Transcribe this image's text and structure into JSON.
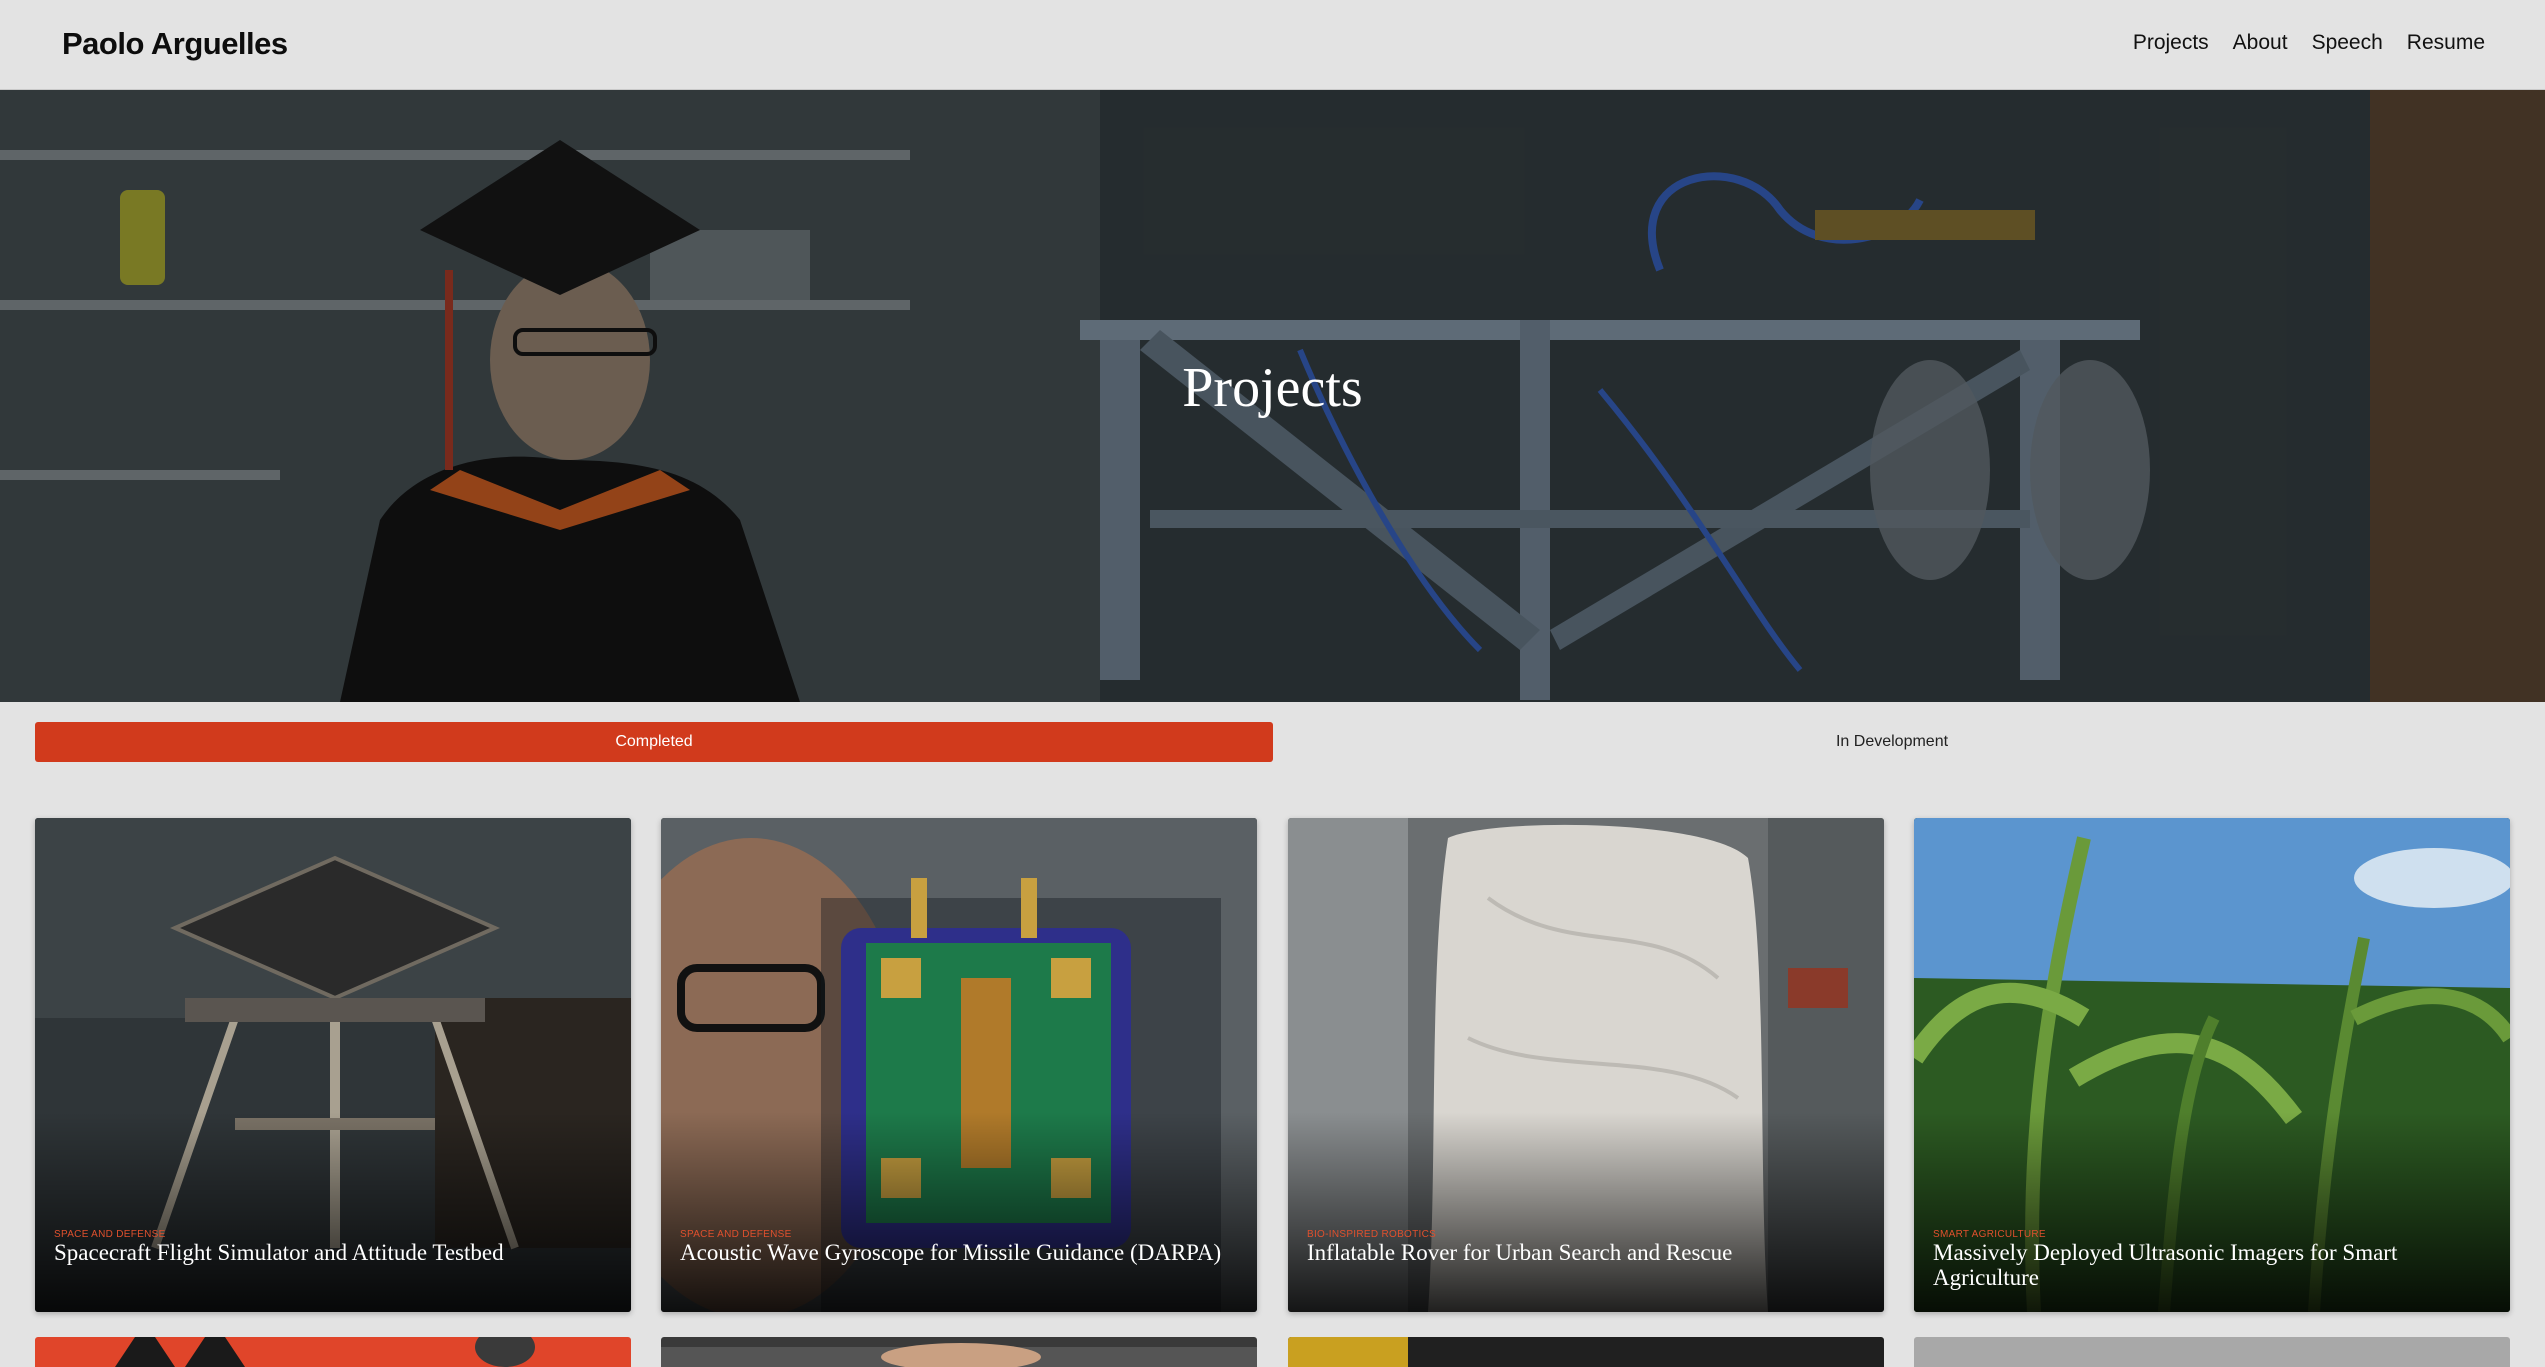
{
  "header": {
    "brand": "Paolo Arguelles",
    "nav": [
      "Projects",
      "About",
      "Speech",
      "Resume"
    ]
  },
  "hero": {
    "title": "Projects"
  },
  "filter_tabs": {
    "active": "Completed",
    "inactive": "In Development"
  },
  "projects": [
    {
      "category": "SPACE AND DEFENSE",
      "title": "Spacecraft Flight Simulator and Attitude Testbed"
    },
    {
      "category": "SPACE AND DEFENSE",
      "title": "Acoustic Wave Gyroscope for Missile Guidance (DARPA)"
    },
    {
      "category": "BIO-INSPIRED ROBOTICS",
      "title": "Inflatable Rover for Urban Search and Rescue"
    },
    {
      "category": "SMART AGRICULTURE",
      "title": "Massively Deployed Ultrasonic Imagers for Smart Agriculture"
    }
  ],
  "colors": {
    "accent": "#d13a1c",
    "background": "#e3e3e3",
    "category": "#e0502d"
  }
}
